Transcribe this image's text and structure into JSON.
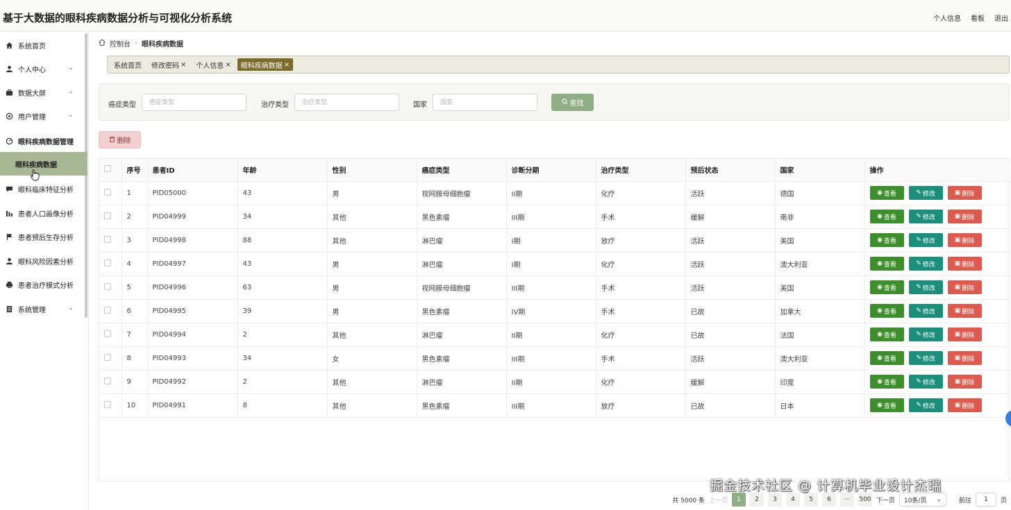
{
  "header": {
    "title": "基于大数据的眼科疾病数据分析与可视化分析系统",
    "links": [
      "个人信息",
      "看板",
      "退出"
    ]
  },
  "sidebar": {
    "items": [
      {
        "label": "系统首页",
        "icon": "home-icon",
        "chevron": false
      },
      {
        "label": "个人中心",
        "icon": "user-icon",
        "chevron": true
      },
      {
        "label": "数据大屏",
        "icon": "briefcase-icon",
        "chevron": true
      },
      {
        "label": "用户管理",
        "icon": "settings-icon",
        "chevron": true
      },
      {
        "label": "眼科疾病数据管理",
        "icon": "dashboard-icon",
        "chevron": false
      },
      {
        "label": "眼科疾病数据",
        "icon": "",
        "chevron": false,
        "active": true
      },
      {
        "label": "眼科临床特征分析",
        "icon": "chat-icon",
        "chevron": false
      },
      {
        "label": "患者人口画像分析",
        "icon": "bar-chart-icon",
        "chevron": false
      },
      {
        "label": "患者预后生存分析",
        "icon": "flag-icon",
        "chevron": false
      },
      {
        "label": "眼科风险因素分析",
        "icon": "user-icon",
        "chevron": false
      },
      {
        "label": "患者治疗模式分析",
        "icon": "printer-icon",
        "chevron": false
      },
      {
        "label": "系统管理",
        "icon": "document-icon",
        "chevron": true
      }
    ]
  },
  "breadcrumb": {
    "home": "控制台",
    "current": "眼科疾病数据"
  },
  "tags": [
    {
      "label": "系统首页",
      "closable": false
    },
    {
      "label": "修改密码",
      "closable": true
    },
    {
      "label": "个人信息",
      "closable": true
    },
    {
      "label": "眼科疾病数据",
      "closable": true,
      "active": true
    }
  ],
  "search": {
    "field1_label": "癌症类型",
    "field1_placeholder": "癌症类型",
    "field2_label": "治疗类型",
    "field2_placeholder": "治疗类型",
    "field3_label": "国家",
    "field3_placeholder": "国家",
    "find_label": "查找"
  },
  "toolbar": {
    "delete_label": "删除"
  },
  "table": {
    "columns": [
      "序号",
      "患者ID",
      "年龄",
      "性别",
      "癌症类型",
      "诊断分期",
      "治疗类型",
      "预后状态",
      "国家",
      "操作"
    ],
    "rows": [
      [
        "1",
        "PID05000",
        "43",
        "男",
        "视网膜母细胞瘤",
        "II期",
        "化疗",
        "活跃",
        "德国"
      ],
      [
        "2",
        "PID04999",
        "34",
        "其他",
        "黑色素瘤",
        "III期",
        "手术",
        "缓解",
        "南非"
      ],
      [
        "3",
        "PID04998",
        "88",
        "其他",
        "淋巴瘤",
        "I期",
        "放疗",
        "活跃",
        "美国"
      ],
      [
        "4",
        "PID04997",
        "43",
        "男",
        "淋巴瘤",
        "I期",
        "化疗",
        "活跃",
        "澳大利亚"
      ],
      [
        "5",
        "PID04996",
        "63",
        "男",
        "视网膜母细胞瘤",
        "III期",
        "手术",
        "活跃",
        "美国"
      ],
      [
        "6",
        "PID04995",
        "39",
        "男",
        "黑色素瘤",
        "IV期",
        "手术",
        "已故",
        "加拿大"
      ],
      [
        "7",
        "PID04994",
        "2",
        "其他",
        "淋巴瘤",
        "II期",
        "化疗",
        "已故",
        "法国"
      ],
      [
        "8",
        "PID04993",
        "34",
        "女",
        "黑色素瘤",
        "III期",
        "手术",
        "活跃",
        "澳大利亚"
      ],
      [
        "9",
        "PID04992",
        "2",
        "其他",
        "淋巴瘤",
        "II期",
        "化疗",
        "缓解",
        "印度"
      ],
      [
        "10",
        "PID04991",
        "8",
        "其他",
        "黑色素瘤",
        "III期",
        "放疗",
        "已故",
        "日本"
      ]
    ],
    "actions": {
      "view": "查看",
      "edit": "修改",
      "delete": "删除"
    }
  },
  "pagination": {
    "total": "共 5000 条",
    "prev": "上一页",
    "pages": [
      "1",
      "2",
      "3",
      "4",
      "5",
      "6",
      "···",
      "500"
    ],
    "current": "1",
    "next": "下一页",
    "page_size": "10条/页",
    "goto_label": "前往",
    "goto_value": "1",
    "page_unit": "页"
  },
  "watermark": "掘金技术社区 @ 计算机毕业设计杰瑞",
  "colors": {
    "accent": "#8fae86",
    "sidebar_active": "#a8b894",
    "view": "#3c8f2a",
    "edit": "#1b8f7b",
    "delete": "#df5a4e",
    "tag_active": "#7a6a2c"
  }
}
